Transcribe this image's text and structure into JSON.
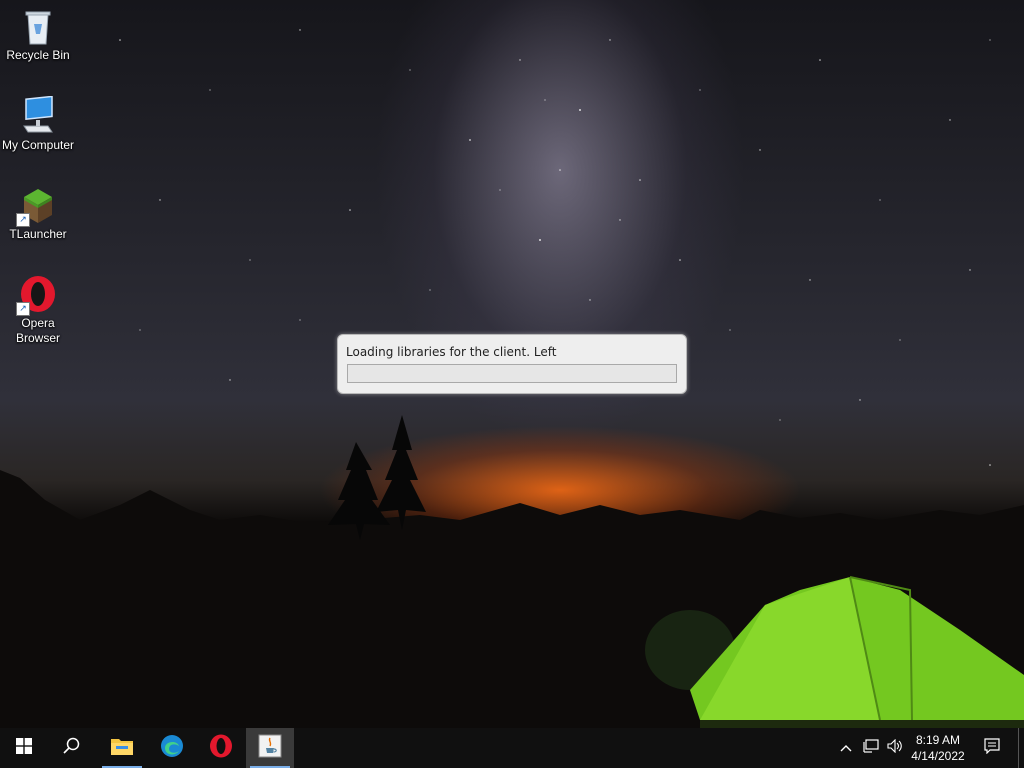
{
  "desktop": {
    "icons": [
      {
        "label": "Recycle Bin",
        "icon": "recycle-bin-icon"
      },
      {
        "label": "My Computer",
        "icon": "computer-icon"
      },
      {
        "label": "TLauncher",
        "icon": "tlauncher-icon"
      },
      {
        "label": "Opera Browser",
        "icon": "opera-icon"
      }
    ]
  },
  "dialog": {
    "message": "Loading libraries for the client. Left",
    "progress": 0
  },
  "taskbar": {
    "apps": [
      {
        "icon": "windows-start-icon"
      },
      {
        "icon": "search-icon"
      },
      {
        "icon": "file-explorer-icon"
      },
      {
        "icon": "edge-icon"
      },
      {
        "icon": "opera-icon"
      },
      {
        "icon": "java-icon",
        "active": true
      }
    ],
    "clock": {
      "time": "8:19 AM",
      "date": "4/14/2022"
    }
  },
  "colors": {
    "accent": "#7aaee8",
    "progress": "#06b025",
    "taskbar": "#101010"
  }
}
